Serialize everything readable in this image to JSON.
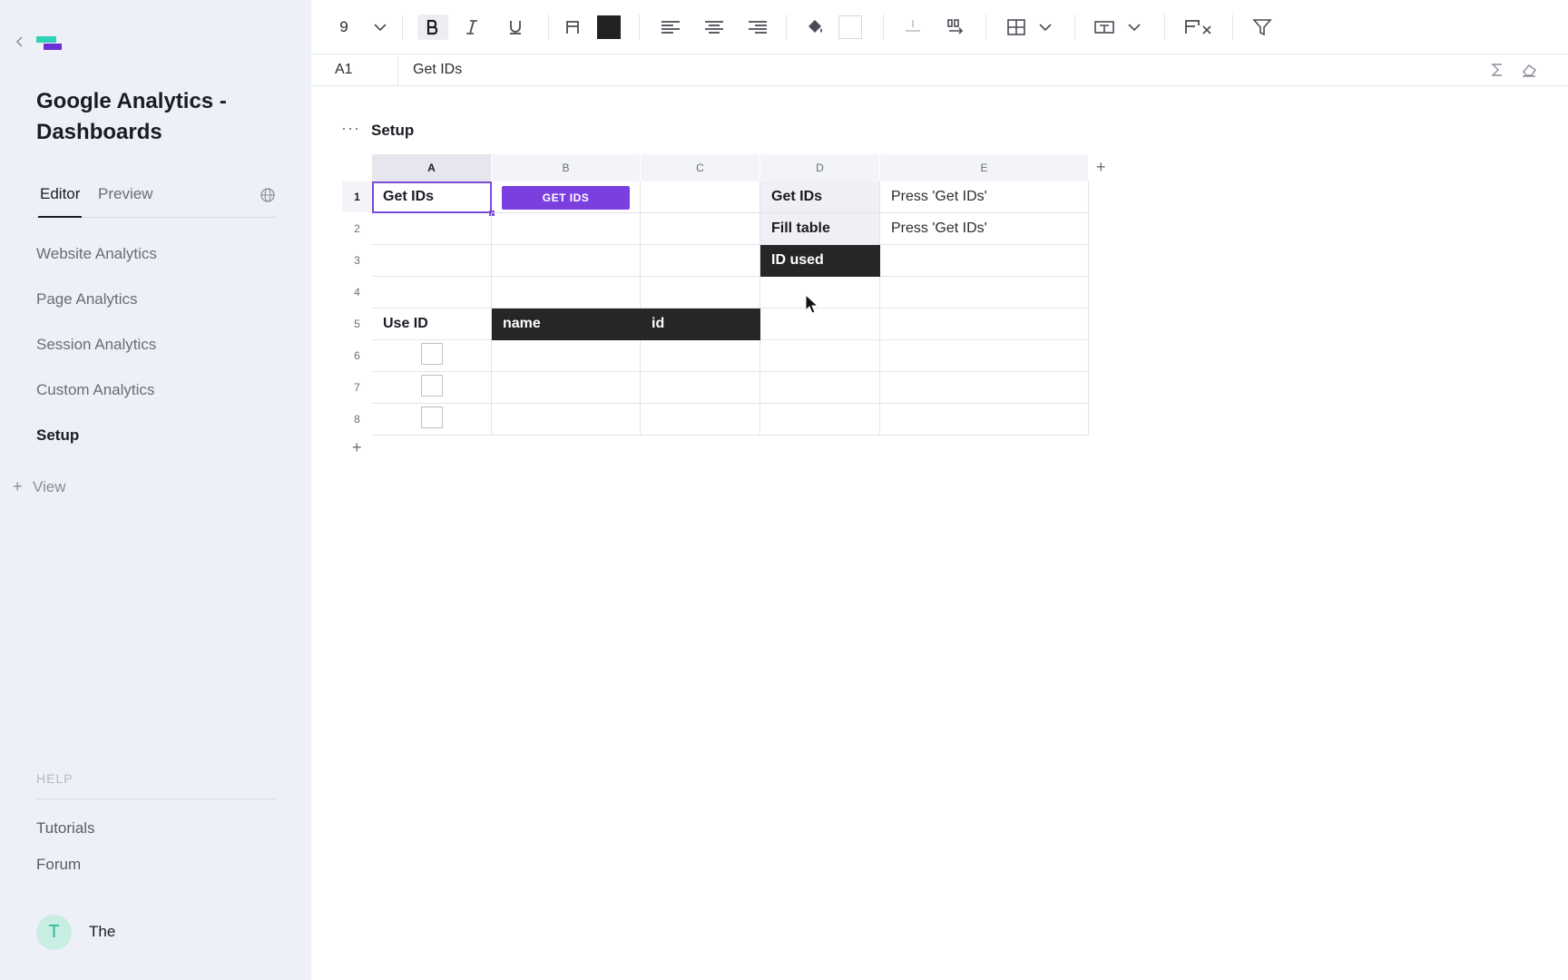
{
  "sidebar": {
    "doc_title": "Google Analytics - Dashboards",
    "tabs": [
      {
        "label": "Editor",
        "active": true
      },
      {
        "label": "Preview",
        "active": false
      }
    ],
    "nav_items": [
      {
        "label": "Website Analytics",
        "active": false
      },
      {
        "label": "Page Analytics",
        "active": false
      },
      {
        "label": "Session Analytics",
        "active": false
      },
      {
        "label": "Custom Analytics",
        "active": false
      },
      {
        "label": "Setup",
        "active": true
      }
    ],
    "add_view_label": "View",
    "help_label": "HELP",
    "help_links": [
      "Tutorials",
      "Forum"
    ],
    "user": {
      "initial": "T",
      "name": "The"
    }
  },
  "toolbar": {
    "font_size": "9",
    "text_color": "#222222",
    "fill_color": "#ffffff"
  },
  "formula_bar": {
    "cell_ref": "A1",
    "value": "Get IDs"
  },
  "sheet": {
    "title": "Setup",
    "columns": [
      "A",
      "B",
      "C",
      "D",
      "E"
    ],
    "rows": [
      "1",
      "2",
      "3",
      "4",
      "5",
      "6",
      "7",
      "8"
    ],
    "cells": {
      "A1": "Get IDs",
      "B1_button": "GET IDS",
      "D1": "Get IDs",
      "E1": "Press 'Get IDs'",
      "D2": "Fill table",
      "E2": "Press 'Get IDs'",
      "D3": "ID used",
      "A5": "Use ID",
      "B5": "name",
      "C5": "id"
    },
    "accent_color": "#7b3fe0",
    "header_dark_color": "#262629"
  }
}
